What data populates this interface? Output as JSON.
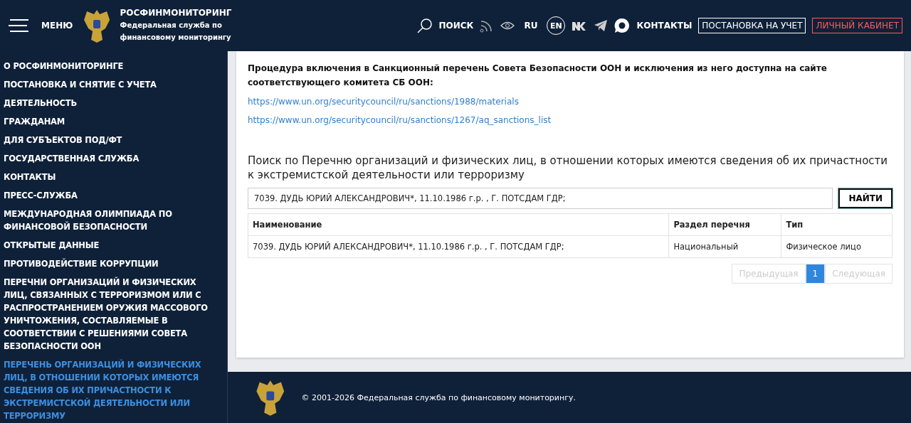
{
  "header": {
    "menu_label": "МЕНЮ",
    "org_name": "РОСФИНМОНИТОРИНГ",
    "org_subtitle": "Федеральная служба по финансовому мониторингу",
    "nav": [
      {
        "kind": "search",
        "label": "ПОИСК"
      },
      {
        "kind": "rss"
      },
      {
        "kind": "eye"
      },
      {
        "kind": "lang",
        "label": "RU",
        "selected": false
      },
      {
        "kind": "lang",
        "label": "EN",
        "selected": true
      },
      {
        "kind": "vk"
      },
      {
        "kind": "telegram"
      },
      {
        "kind": "chat"
      },
      {
        "kind": "text",
        "label": "КОНТАКТЫ"
      },
      {
        "kind": "outline",
        "label": "ПОСТАНОВКА НА УЧЕТ"
      },
      {
        "kind": "accent",
        "label": "ЛИЧНЫЙ КАБИНЕТ"
      }
    ]
  },
  "sidebar": {
    "items": [
      {
        "label": "О РОСФИНМОНИТОРИНГЕ",
        "selected": false
      },
      {
        "label": "ПОСТАНОВКА И СНЯТИЕ С УЧЕТА",
        "selected": false
      },
      {
        "label": "ДЕЯТЕЛЬНОСТЬ",
        "selected": false
      },
      {
        "label": "ГРАЖДАНАМ",
        "selected": false
      },
      {
        "label": "ДЛЯ СУБЪЕКТОВ ПОД/ФТ",
        "selected": false
      },
      {
        "label": "ГОСУДАРСТВЕННАЯ СЛУЖБА",
        "selected": false
      },
      {
        "label": "КОНТАКТЫ",
        "selected": false
      },
      {
        "label": "ПРЕСС-СЛУЖБА",
        "selected": false
      },
      {
        "label": "МЕЖДУНАРОДНАЯ ОЛИМПИАДА ПО ФИНАНСОВОЙ БЕЗОПАСНОСТИ",
        "selected": false
      },
      {
        "label": "ОТКРЫТЫЕ ДАННЫЕ",
        "selected": false
      },
      {
        "label": "ПРОТИВОДЕЙСТВИЕ КОРРУПЦИИ",
        "selected": false
      },
      {
        "label": "ПЕРЕЧНИ ОРГАНИЗАЦИЙ И ФИЗИЧЕСКИХ ЛИЦ, СВЯЗАННЫХ С ТЕРРОРИЗМОМ ИЛИ С РАСПРОСТРАНЕНИЕМ ОРУЖИЯ МАССОВОГО УНИЧТОЖЕНИЯ, СОСТАВЛЯЕМЫЕ В СООТВЕТСТВИИ С РЕШЕНИЯМИ СОВЕТА БЕЗОПАСНОСТИ ООН",
        "selected": false
      },
      {
        "label": "ПЕРЕЧЕНЬ ОРГАНИЗАЦИЙ И ФИЗИЧЕСКИХ ЛИЦ, В ОТНОШЕНИИ КОТОРЫХ ИМЕЮТСЯ СВЕДЕНИЯ ОБ ИХ ПРИЧАСТНОСТИ К ЭКСТРЕМИСТСКОЙ ДЕЯТЕЛЬНОСТИ ИЛИ ТЕРРОРИЗМУ",
        "selected": true
      }
    ]
  },
  "content": {
    "notice": "Процедура включения в Санкционный перечень Совета Безопасности ООН и исключения из него доступна на сайте соответствующего комитета СБ ООН:",
    "links": [
      "https://www.un.org/securitycouncil/ru/sanctions/1988/materials",
      "https://www.un.org/securitycouncil/ru/sanctions/1267/aq_sanctions_list"
    ],
    "search_title": "Поиск по Перечню организаций и физических лиц, в отношении которых имеются сведения об их причастности к экстремистской деятельности или терроризму",
    "search_value": "7039. ДУДЬ ЮРИЙ АЛЕКСАНДРОВИЧ*, 11.10.1986 г.р. , Г. ПОТСДАМ ГДР;",
    "search_button": "НАЙТИ",
    "table": {
      "columns": [
        "Наименование",
        "Раздел перечня",
        "Тип"
      ],
      "rows": [
        [
          "7039. ДУДЬ ЮРИЙ АЛЕКСАНДРОВИЧ*, 11.10.1986 г.р. , Г. ПОТСДАМ ГДР;",
          "Национальный",
          "Физическое лицо"
        ]
      ]
    },
    "pagination": {
      "prev": {
        "label": "Предыдущая",
        "disabled": true
      },
      "pages": [
        {
          "label": "1",
          "selected": true
        }
      ],
      "next": {
        "label": "Следующая",
        "disabled": true
      }
    }
  },
  "footer": {
    "copyright": "© 2001-2026 Федеральная служба по финансовому мониторингу."
  }
}
